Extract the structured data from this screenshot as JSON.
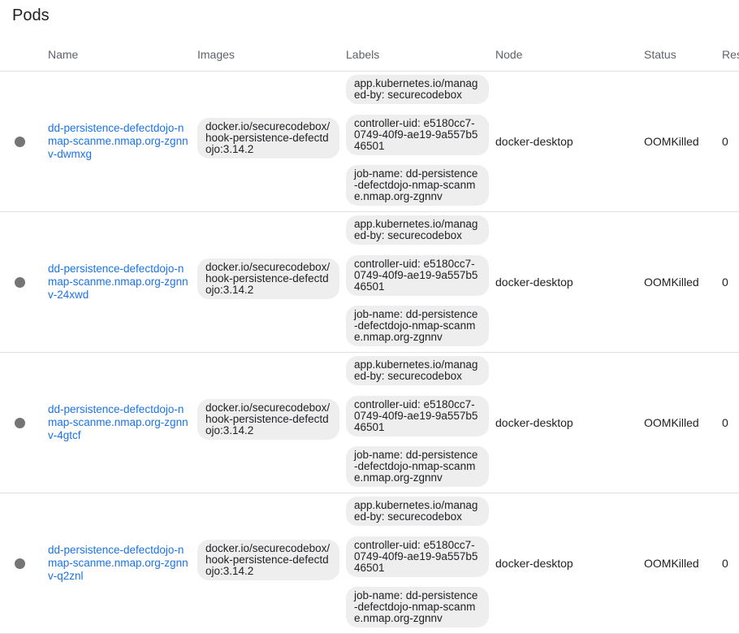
{
  "page": {
    "title": "Pods"
  },
  "table": {
    "columns": {
      "name": "Name",
      "images": "Images",
      "labels": "Labels",
      "node": "Node",
      "status": "Status",
      "restarts": "Res"
    },
    "rows": [
      {
        "name": "dd-persistence-defectdojo-nmap-scanme.nmap.org-zgnnv-dwmxg",
        "image": "docker.io/securecodebox/hook-persistence-defectdojo:3.14.2",
        "labels": [
          "app.kubernetes.io/managed-by: securecodebox",
          "controller-uid: e5180cc7-0749-40f9-ae19-9a557b546501",
          "job-name: dd-persistence-defectdojo-nmap-scanme.nmap.org-zgnnv"
        ],
        "node": "docker-desktop",
        "status": "OOMKilled",
        "restarts": "0"
      },
      {
        "name": "dd-persistence-defectdojo-nmap-scanme.nmap.org-zgnnv-24xwd",
        "image": "docker.io/securecodebox/hook-persistence-defectdojo:3.14.2",
        "labels": [
          "app.kubernetes.io/managed-by: securecodebox",
          "controller-uid: e5180cc7-0749-40f9-ae19-9a557b546501",
          "job-name: dd-persistence-defectdojo-nmap-scanme.nmap.org-zgnnv"
        ],
        "node": "docker-desktop",
        "status": "OOMKilled",
        "restarts": "0"
      },
      {
        "name": "dd-persistence-defectdojo-nmap-scanme.nmap.org-zgnnv-4gtcf",
        "image": "docker.io/securecodebox/hook-persistence-defectdojo:3.14.2",
        "labels": [
          "app.kubernetes.io/managed-by: securecodebox",
          "controller-uid: e5180cc7-0749-40f9-ae19-9a557b546501",
          "job-name: dd-persistence-defectdojo-nmap-scanme.nmap.org-zgnnv"
        ],
        "node": "docker-desktop",
        "status": "OOMKilled",
        "restarts": "0"
      },
      {
        "name": "dd-persistence-defectdojo-nmap-scanme.nmap.org-zgnnv-q2znl",
        "image": "docker.io/securecodebox/hook-persistence-defectdojo:3.14.2",
        "labels": [
          "app.kubernetes.io/managed-by: securecodebox",
          "controller-uid: e5180cc7-0749-40f9-ae19-9a557b546501",
          "job-name: dd-persistence-defectdojo-nmap-scanme.nmap.org-zgnnv"
        ],
        "node": "docker-desktop",
        "status": "OOMKilled",
        "restarts": "0"
      }
    ]
  },
  "colors": {
    "link": "#1a73e8",
    "status_dot": "#757575",
    "chip_bg": "#eeeeee"
  }
}
